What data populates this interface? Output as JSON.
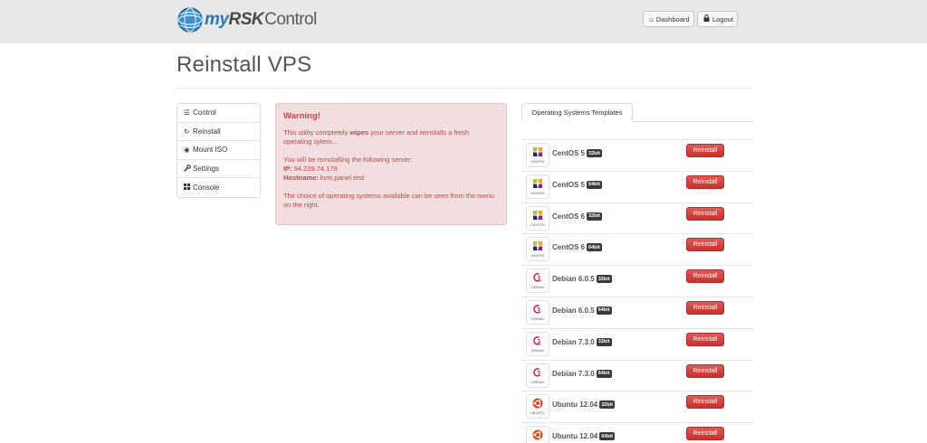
{
  "header": {
    "logo": {
      "my": "my",
      "rsk": "RSK",
      "control": "Control"
    },
    "buttons": [
      {
        "label": "Dashboard",
        "icon": "home-icon"
      },
      {
        "label": "Logout",
        "icon": "lock-icon"
      }
    ]
  },
  "page": {
    "title": "Reinstall VPS"
  },
  "sidebar": {
    "items": [
      {
        "label": "Control",
        "icon": "list-icon",
        "glyph": "☰"
      },
      {
        "label": "Reinstall",
        "icon": "refresh-icon",
        "glyph": "↻"
      },
      {
        "label": "Mount ISO",
        "icon": "disc-icon",
        "glyph": "◉"
      },
      {
        "label": "Settings",
        "icon": "wrench-icon",
        "glyph": "🔧"
      },
      {
        "label": "Console",
        "icon": "grid-icon",
        "glyph": "▦"
      }
    ]
  },
  "alert": {
    "title": "Warning!",
    "line1_pre": "This utility completely ",
    "line1_bold": "wipes",
    "line1_post": " your server and reinstalls a fresh operating sytem...",
    "line2": "You will be reinstalling the following server:",
    "ip_label": "IP:",
    "ip_value": "94.229.74.179",
    "host_label": "Hostname:",
    "host_value": "kvm.panel.test",
    "line3": "The choice of operating systems available can be seen from the menu on the right."
  },
  "templates": {
    "tab_label": "Operating Systems Templates",
    "button_label": "Reinstall",
    "items": [
      {
        "name": "CentOS 5",
        "arch": "32bit",
        "logo": "centos-logo-icon",
        "caption": "CENTOS"
      },
      {
        "name": "CentOS 5",
        "arch": "64bit",
        "logo": "centos-logo-icon",
        "caption": "CENTOS"
      },
      {
        "name": "CentOS 6",
        "arch": "32bit",
        "logo": "centos-logo-icon",
        "caption": "CENTOS"
      },
      {
        "name": "CentOS 6",
        "arch": "64bit",
        "logo": "centos-logo-icon",
        "caption": "CENTOS"
      },
      {
        "name": "Debian 6.0.5",
        "arch": "32bit",
        "logo": "debian-logo-icon",
        "caption": "DEBIAN"
      },
      {
        "name": "Debian 6.0.5",
        "arch": "64bit",
        "logo": "debian-logo-icon",
        "caption": "DEBIAN"
      },
      {
        "name": "Debian 7.3.0",
        "arch": "32bit",
        "logo": "debian-logo-icon",
        "caption": "DEBIAN"
      },
      {
        "name": "Debian 7.3.0",
        "arch": "64bit",
        "logo": "debian-logo-icon",
        "caption": "DEBIAN"
      },
      {
        "name": "Ubuntu 12.04",
        "arch": "32bit",
        "logo": "ubuntu-logo-icon",
        "caption": "UBUNTU"
      },
      {
        "name": "Ubuntu 12.04",
        "arch": "64bit",
        "logo": "ubuntu-logo-icon",
        "caption": "UBUNTU"
      }
    ]
  },
  "colors": {
    "topbar": "#e8e8e8",
    "alert_bg": "#f2dede",
    "alert_text": "#b94a48",
    "danger": "#d9534f",
    "logo_blue": "#2a78b8"
  }
}
